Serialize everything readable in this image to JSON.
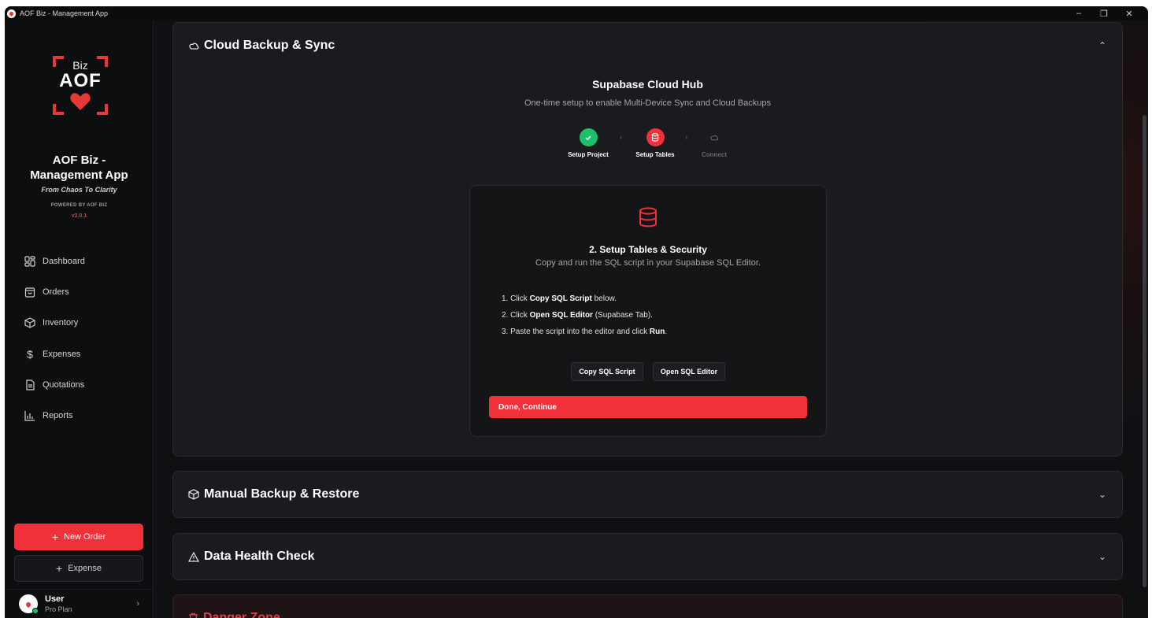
{
  "window": {
    "title": "AOF Biz - Management App",
    "controls": [
      "–",
      "❐",
      "✕"
    ]
  },
  "sidebar": {
    "logo": {
      "biz": "Biz",
      "aof": "AOF"
    },
    "app_name_line1": "AOF Biz -",
    "app_name_line2": "Management App",
    "tagline": "From Chaos To Clarity",
    "powered_by": "POWERED BY AOF BIZ",
    "version": "v2.0.1",
    "nav": [
      {
        "label": "Dashboard",
        "icon": "dashboard-icon"
      },
      {
        "label": "Orders",
        "icon": "orders-icon"
      },
      {
        "label": "Inventory",
        "icon": "inventory-icon"
      },
      {
        "label": "Expenses",
        "icon": "dollar-icon"
      },
      {
        "label": "Quotations",
        "icon": "document-icon"
      },
      {
        "label": "Reports",
        "icon": "bar-chart-icon"
      }
    ],
    "new_order_label": "New Order",
    "expense_label": "Expense",
    "user": {
      "name": "User",
      "plan": "Pro Plan"
    }
  },
  "main": {
    "cloud_panel": {
      "title": "Cloud Backup & Sync",
      "hub_title": "Supabase Cloud Hub",
      "hub_subtitle": "One-time setup to enable Multi-Device Sync and Cloud Backups",
      "steps": [
        {
          "label": "Setup Project",
          "state": "done"
        },
        {
          "label": "Setup Tables",
          "state": "active"
        },
        {
          "label": "Connect",
          "state": "pending"
        }
      ],
      "card": {
        "title": "2. Setup Tables & Security",
        "subtitle": "Copy and run the SQL script in your Supabase SQL Editor.",
        "instructions": [
          {
            "pre": "1. Click ",
            "bold": "Copy SQL Script",
            "post": " below."
          },
          {
            "pre": "2. Click ",
            "bold": "Open SQL Editor",
            "post": " (Supabase Tab)."
          },
          {
            "pre": "3. Paste the script into the editor and click ",
            "bold": "Run",
            "post": "."
          }
        ],
        "copy_button": "Copy SQL Script",
        "open_button": "Open SQL Editor",
        "continue_button": "Done, Continue"
      }
    },
    "manual_panel": {
      "title": "Manual Backup & Restore"
    },
    "health_panel": {
      "title": "Data Health Check"
    },
    "danger_panel": {
      "title": "Danger Zone"
    }
  },
  "colors": {
    "accent": "#f0313a",
    "success": "#1fbf6a",
    "background": "#0f1012"
  }
}
